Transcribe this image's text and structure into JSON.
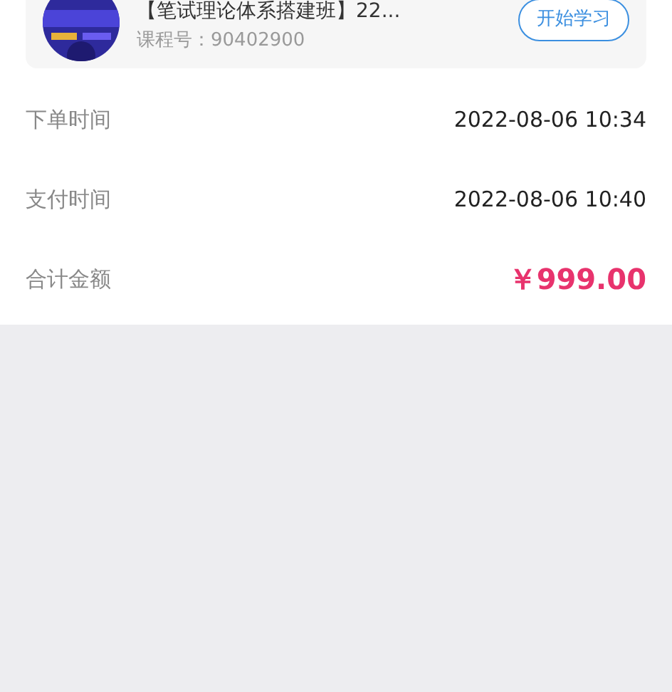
{
  "course": {
    "title": "【笔试理论体系搭建班】22...",
    "code_label": "课程号：",
    "code": "90402900",
    "button": "开始学习"
  },
  "rows": [
    {
      "label": "下单时间",
      "value": "2022-08-06 10:34",
      "kind": "plain"
    },
    {
      "label": "支付时间",
      "value": "2022-08-06 10:40",
      "kind": "plain"
    },
    {
      "label": "合计金额",
      "value": "￥999.00",
      "kind": "price"
    }
  ]
}
